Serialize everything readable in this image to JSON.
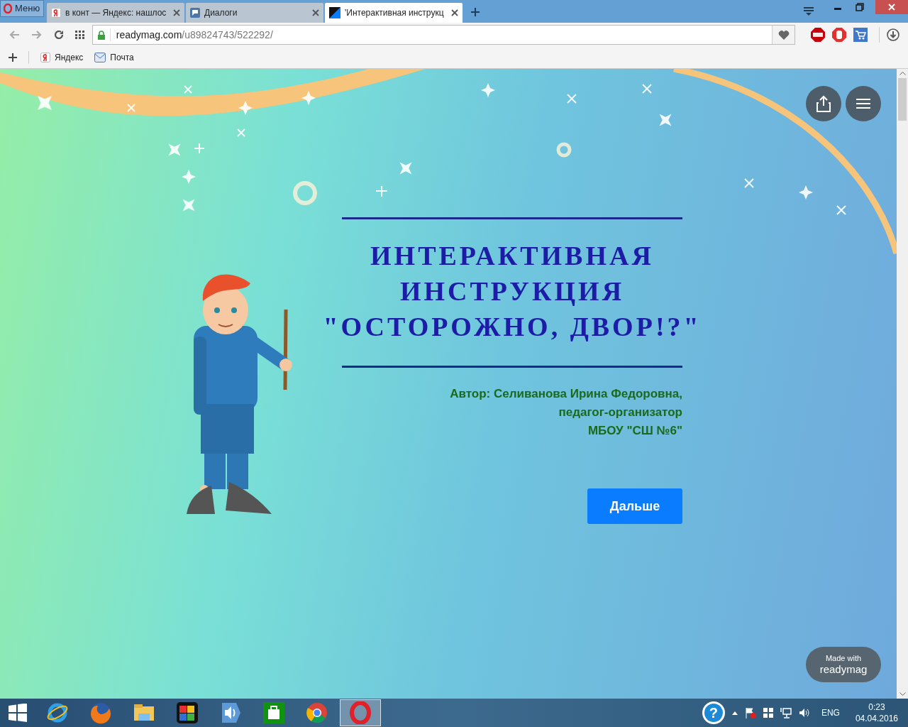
{
  "browser": {
    "menu_label": "Меню",
    "tabs": [
      {
        "kind": "yandex",
        "label": "в конт — Яндекс: нашлос",
        "selected": false
      },
      {
        "kind": "dialog",
        "label": "Диалоги",
        "selected": false
      },
      {
        "kind": "readymag",
        "label": "'Интерактивная инструкц",
        "selected": true
      }
    ],
    "address": {
      "host": "readymag.com",
      "path": "/u89824743/522292/"
    },
    "bookmarks": [
      {
        "kind": "yandex",
        "label": "Яндекс"
      },
      {
        "kind": "mail",
        "label": "Почта"
      }
    ]
  },
  "page": {
    "title_lines": [
      "ИНТЕРАКТИВНАЯ",
      "ИНСТРУКЦИЯ",
      "\"ОСТОРОЖНО, ДВОР!?\""
    ],
    "author_lines": [
      "Автор: Селиванова Ирина Федоровна,",
      "педагог-организатор",
      "МБОУ \"СШ №6\""
    ],
    "next_button": "Дальше",
    "badge": {
      "line_1": "Made with",
      "line_2": "readymag"
    }
  },
  "taskbar": {
    "apps": [
      {
        "kind": "ie",
        "selected": false
      },
      {
        "kind": "firefox",
        "selected": false
      },
      {
        "kind": "explorer",
        "selected": false
      },
      {
        "kind": "puzzle",
        "selected": false
      },
      {
        "kind": "audio",
        "selected": false
      },
      {
        "kind": "store",
        "selected": false
      },
      {
        "kind": "chrome",
        "selected": false
      },
      {
        "kind": "opera",
        "selected": true
      }
    ],
    "help_label": "?",
    "language": "ENG",
    "time": "0:23",
    "date": "04.04.2016"
  }
}
